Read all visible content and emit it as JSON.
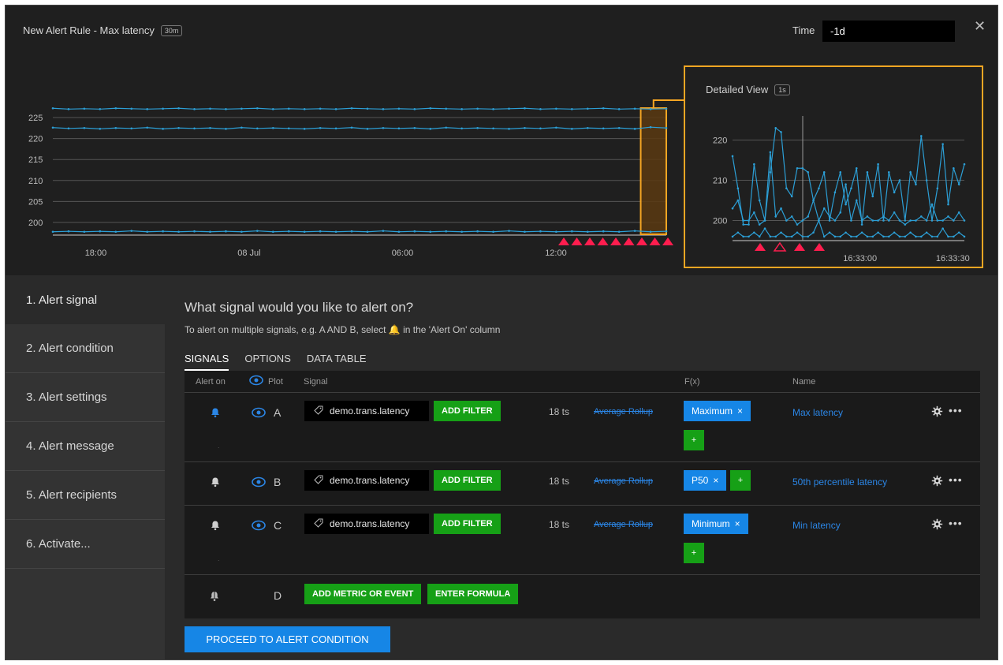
{
  "header": {
    "title": "New Alert Rule - Max latency",
    "title_badge": "30m",
    "time_label": "Time",
    "time_value": "-1d",
    "close_icon": "close-icon"
  },
  "main_chart": {
    "y_ticks": [
      "225",
      "220",
      "215",
      "210",
      "205",
      "200"
    ],
    "x_ticks": [
      "18:00",
      "08 Jul",
      "06:00",
      "12:00"
    ]
  },
  "detail_view": {
    "title": "Detailed View",
    "badge": "1s",
    "y_ticks": [
      "220",
      "210",
      "200"
    ],
    "x_ticks": [
      "16:33:00",
      "16:33:30"
    ]
  },
  "chart_data": [
    {
      "type": "line",
      "title": "",
      "ylim": [
        197,
        228
      ],
      "y_ticks": [
        200,
        205,
        210,
        215,
        220,
        225
      ],
      "x_ticks": [
        "18:00",
        "08 Jul",
        "06:00",
        "12:00"
      ],
      "series": [
        {
          "values": [
            227.2,
            227.0,
            227.1,
            227.0,
            227.2,
            227.1,
            227.0,
            227.1,
            227.2,
            227.0,
            227.1,
            227.0,
            227.1,
            227.2,
            227.0,
            227.1,
            227.0,
            227.1,
            227.0,
            227.2,
            227.1,
            227.0,
            227.1,
            227.0,
            227.2,
            227.1,
            227.0,
            227.1,
            227.0,
            227.1,
            227.2,
            227.0,
            227.1,
            227.0,
            227.1,
            227.2,
            227.0,
            227.1,
            227.0,
            227.1
          ]
        },
        {
          "values": [
            222.6,
            222.4,
            222.5,
            222.3,
            222.5,
            222.4,
            222.6,
            222.3,
            222.5,
            222.4,
            222.5,
            222.3,
            222.6,
            222.4,
            222.5,
            222.4,
            222.3,
            222.5,
            222.4,
            222.6,
            222.3,
            222.5,
            222.4,
            222.5,
            222.3,
            222.6,
            222.4,
            222.5,
            222.4,
            222.3,
            222.5,
            222.4,
            222.6,
            222.3,
            222.5,
            222.4,
            222.5,
            222.3,
            222.7,
            222.5
          ]
        },
        {
          "values": [
            197.8,
            197.9,
            197.8,
            197.9,
            197.8,
            198.0,
            197.8,
            197.9,
            197.8,
            197.9,
            197.8,
            197.9,
            197.8,
            198.0,
            197.8,
            197.9,
            197.8,
            197.9,
            197.8,
            197.9,
            197.8,
            198.0,
            197.8,
            197.9,
            197.8,
            197.9,
            197.8,
            197.9,
            197.8,
            198.0,
            197.8,
            197.9,
            197.8,
            197.9,
            197.8,
            197.9,
            197.8,
            198.0,
            197.8,
            197.9
          ]
        }
      ],
      "alert_markers": 9,
      "highlight_range": [
        0.93,
        1.0
      ]
    },
    {
      "type": "line",
      "title": "Detailed View",
      "ylim": [
        195,
        226
      ],
      "y_ticks": [
        200,
        210,
        220
      ],
      "x_ticks": [
        "16:33:00",
        "16:33:30"
      ],
      "series": [
        {
          "values": [
            216,
            208,
            199,
            199,
            214,
            205,
            200,
            212,
            223,
            222,
            208,
            206,
            213,
            213,
            212,
            205,
            208,
            212,
            200,
            207,
            212,
            204,
            208,
            213,
            199,
            212,
            206,
            214,
            200,
            212,
            207,
            210,
            200,
            212,
            209,
            221,
            210,
            200,
            208,
            219,
            204,
            213,
            209,
            214
          ]
        },
        {
          "values": [
            203,
            205,
            200,
            200,
            202,
            199,
            200,
            217,
            201,
            203,
            200,
            201,
            199,
            200,
            201,
            205,
            200,
            203,
            201,
            200,
            202,
            209,
            200,
            205,
            200,
            201,
            200,
            200,
            201,
            200,
            202,
            200,
            199,
            200,
            200,
            201,
            200,
            204,
            200,
            200,
            201,
            200,
            202,
            200
          ]
        },
        {
          "values": [
            196,
            197,
            196,
            196,
            197,
            196,
            198,
            196,
            196,
            197,
            196,
            196,
            197,
            196,
            196,
            197,
            200,
            196,
            197,
            196,
            196,
            197,
            196,
            196,
            197,
            196,
            196,
            197,
            196,
            196,
            197,
            196,
            196,
            197,
            196,
            196,
            197,
            196,
            196,
            198,
            196,
            196,
            197,
            196
          ]
        }
      ],
      "alert_markers": [
        {
          "filled": true
        },
        {
          "filled": false
        },
        {
          "filled": true
        },
        {
          "filled": true
        }
      ]
    }
  ],
  "steps": [
    {
      "label": "1. Alert signal",
      "active": true
    },
    {
      "label": "2. Alert condition",
      "active": false
    },
    {
      "label": "3. Alert settings",
      "active": false
    },
    {
      "label": "4. Alert message",
      "active": false
    },
    {
      "label": "5. Alert recipients",
      "active": false
    },
    {
      "label": "6. Activate...",
      "active": false
    }
  ],
  "panel": {
    "question": "What signal would you like to alert on?",
    "subtitle": "To alert on multiple signals, e.g. A AND B, select 🔔 in the 'Alert On' column",
    "tabs": [
      "SIGNALS",
      "OPTIONS",
      "DATA TABLE"
    ],
    "columns": {
      "alert_on": "Alert on",
      "plot": "Plot",
      "signal": "Signal",
      "fx": "F(x)",
      "name": "Name"
    },
    "rows": [
      {
        "letter": "A",
        "signal": "demo.trans.latency",
        "add_filter": "ADD FILTER",
        "ts": "18 ts",
        "rollup": "Average Rollup",
        "fx": "Maximum",
        "fx_plus": "+",
        "name": "Max latency",
        "alert_on": true
      },
      {
        "letter": "B",
        "signal": "demo.trans.latency",
        "add_filter": "ADD FILTER",
        "ts": "18 ts",
        "rollup": "Average Rollup",
        "fx": "P50",
        "fx_plus": "+",
        "name": "50th percentile latency",
        "alert_on": false
      },
      {
        "letter": "C",
        "signal": "demo.trans.latency",
        "add_filter": "ADD FILTER",
        "ts": "18 ts",
        "rollup": "Average Rollup",
        "fx": "Minimum",
        "fx_plus": "+",
        "name": "Min latency",
        "alert_on": false
      }
    ],
    "new_row": {
      "letter": "D",
      "add_metric": "ADD METRIC OR EVENT",
      "enter_formula": "ENTER FORMULA"
    },
    "proceed": "PROCEED TO ALERT CONDITION"
  },
  "colors": {
    "accent_blue": "#1686e6",
    "green": "#16a016",
    "line_blue": "#2c9fd6",
    "alert_red": "#ff1d4e",
    "highlight_orange": "#f6a623"
  }
}
